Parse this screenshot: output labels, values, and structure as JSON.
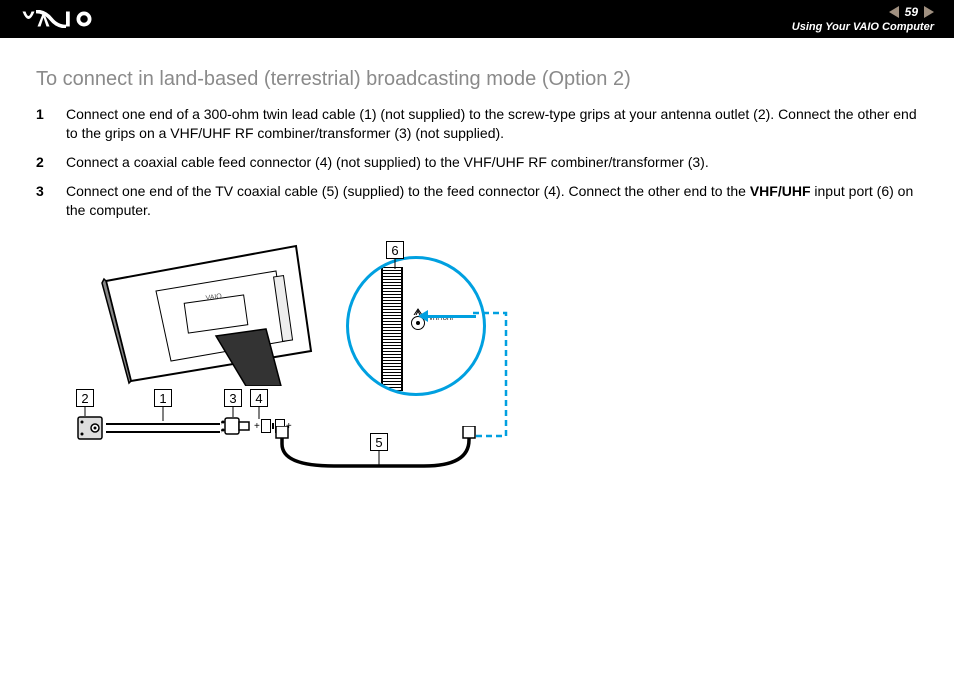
{
  "header": {
    "page_number": "59",
    "section_title": "Using Your VAIO Computer"
  },
  "content": {
    "title": "To connect in land-based (terrestrial) broadcasting mode (Option 2)",
    "steps": [
      {
        "num": "1",
        "text_a": "Connect one end of a 300-ohm twin lead cable (1) (not supplied) to the screw-type grips at your antenna outlet (2). Connect the other end to the grips on a VHF/UHF RF combiner/transformer (3) (not supplied)."
      },
      {
        "num": "2",
        "text_a": "Connect a coaxial cable feed connector (4) (not supplied) to the VHF/UHF RF combiner/transformer (3)."
      },
      {
        "num": "3",
        "text_a": "Connect one end of the TV coaxial cable (5) (supplied) to the feed connector (4). Connect the other end to the ",
        "bold": "VHF/UHF",
        "text_b": " input port (6) on the computer."
      }
    ]
  },
  "diagram": {
    "callouts": {
      "c1": "1",
      "c2": "2",
      "c3": "3",
      "c4": "4",
      "c5": "5",
      "c6": "6"
    },
    "port_label": "VHF/UHF"
  }
}
